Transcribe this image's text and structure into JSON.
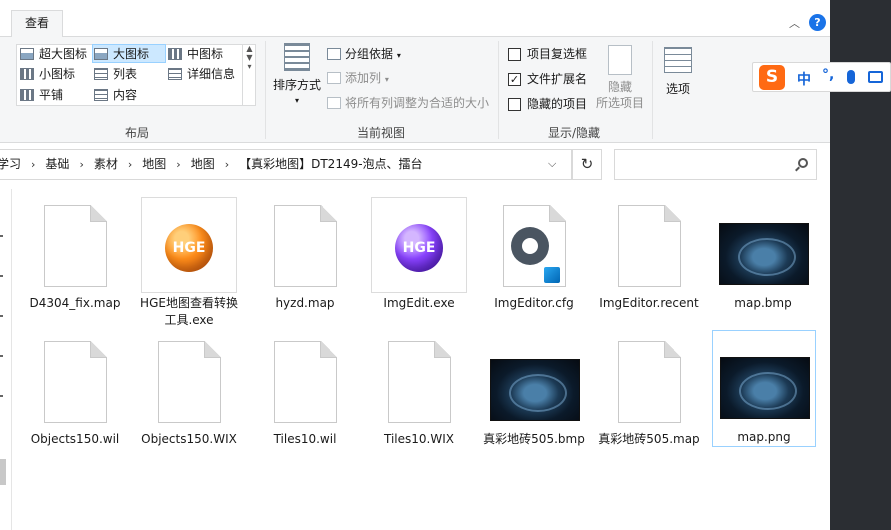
{
  "ribbon": {
    "tab_view": "查看",
    "layout": {
      "items": [
        "超大图标",
        "大图标",
        "中图标",
        "小图标",
        "列表",
        "详细信息",
        "平铺",
        "内容"
      ],
      "selected": "大图标",
      "group_label": "布局"
    },
    "current_view": {
      "sort_label": "排序方式",
      "group_by": "分组依据",
      "add_column": "添加列",
      "fit_columns": "将所有列调整为合适的大小",
      "group_label": "当前视图"
    },
    "show_hide": {
      "item_checkboxes": "项目复选框",
      "file_extensions": "文件扩展名",
      "hidden_items": "隐藏的项目",
      "item_checkboxes_checked": false,
      "file_extensions_checked": true,
      "hidden_items_checked": false,
      "hide_btn_line1": "隐藏",
      "hide_btn_line2": "所选项目",
      "group_label": "显示/隐藏"
    },
    "options_label": "选项",
    "help_glyph": "?"
  },
  "ime": {
    "logo": "S",
    "mode": "中",
    "punct": "°,"
  },
  "address": {
    "crumbs": [
      "学习",
      "基础",
      "素材",
      "地图",
      "地图",
      "【真彩地图】DT2149-泡点、擂台"
    ],
    "refresh_glyph": "↻"
  },
  "files": [
    {
      "name": "D4304_fix.map",
      "kind": "doc"
    },
    {
      "name": "HGE地图查看转换工具.exe",
      "kind": "hge-orange",
      "logo_text": "HGE"
    },
    {
      "name": "hyzd.map",
      "kind": "doc"
    },
    {
      "name": "ImgEdit.exe",
      "kind": "hge-purple",
      "logo_text": "HGE"
    },
    {
      "name": "ImgEditor.cfg",
      "kind": "cfg"
    },
    {
      "name": "ImgEditor.recent",
      "kind": "doc"
    },
    {
      "name": "map.bmp",
      "kind": "image"
    },
    {
      "name": "Objects150.wil",
      "kind": "doc"
    },
    {
      "name": "Objects150.WIX",
      "kind": "doc"
    },
    {
      "name": "Tiles10.wil",
      "kind": "doc"
    },
    {
      "name": "Tiles10.WIX",
      "kind": "doc"
    },
    {
      "name": "真彩地砖505.bmp",
      "kind": "image"
    },
    {
      "name": "真彩地砖505.map",
      "kind": "doc"
    },
    {
      "name": "map.png",
      "kind": "image",
      "selected": true
    }
  ],
  "colors": {
    "selection_bg": "#cce8ff",
    "selection_border": "#99d1ff",
    "ime_brand": "#ff6a13",
    "ime_blue": "#1565d8",
    "dark_panel": "#2b2e33"
  }
}
